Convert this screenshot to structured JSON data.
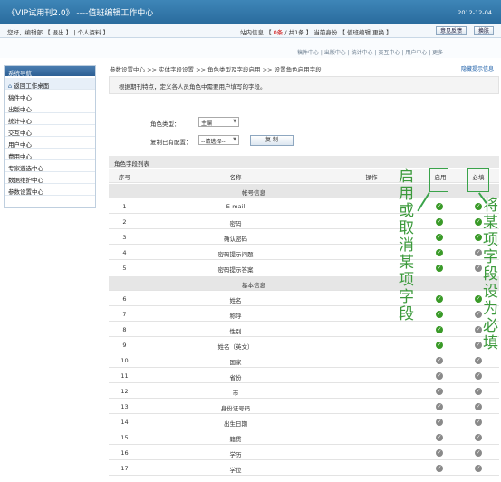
{
  "app": {
    "title": "《VIP试用刊2.0》 ----值班编辑工作中心",
    "date": "2012-12-04"
  },
  "userbar": {
    "left": "您好，编辑部 【 退出 】 | 个人资料 】",
    "right_prefix": "站内信息 【 ",
    "right_count": "0条",
    "right_suffix": " / 共1条 】   当前身份 【 值班编辑 更换 】",
    "help_label": "意见反馈",
    "switch_label": "换肤"
  },
  "nav": {
    "links": "稿件中心 | 出版中心 | 统计中心 | 交互中心 | 用户中心 | 更多"
  },
  "sidebar": {
    "title": "系统导航",
    "home": "返回工作桌面",
    "items": [
      "稿件中心",
      "出版中心",
      "统计中心",
      "交互中心",
      "用户中心",
      "费用中心",
      "专家遴选中心",
      "数据维护中心",
      "参数设置中心"
    ]
  },
  "breadcrumb": "参数设置中心 >> 实体字段设置 >> 角色类型及字段启用 >> 设置角色启用字段",
  "hide_tip": "隐藏提示信息",
  "description": "根据期刊特点，定义各人员角色中需要用户填写的字段。",
  "form": {
    "role_label": "角色类型：",
    "role_value": "主编",
    "copy_label": "复制已有配置：",
    "copy_value": "--请选择--",
    "copy_button": "复 制"
  },
  "table": {
    "title": "角色字段列表",
    "headers": {
      "no": "序号",
      "name": "名称",
      "op": "操作",
      "enable": "启用",
      "required": "必填"
    },
    "group1": "帐号信息",
    "rows1": [
      {
        "no": "1",
        "name": "E-mail",
        "enable": true,
        "required": true
      },
      {
        "no": "2",
        "name": "密码",
        "enable": true,
        "required": true
      },
      {
        "no": "3",
        "name": "确认密码",
        "enable": true,
        "required": true
      },
      {
        "no": "4",
        "name": "密码提示问题",
        "enable": true,
        "required": false
      },
      {
        "no": "5",
        "name": "密码提示答案",
        "enable": true,
        "required": false
      }
    ],
    "group2": "基本信息",
    "rows2": [
      {
        "no": "6",
        "name": "姓名",
        "enable": true,
        "required": true
      },
      {
        "no": "7",
        "name": "称呼",
        "enable": true,
        "required": false
      },
      {
        "no": "8",
        "name": "性别",
        "enable": true,
        "required": false
      },
      {
        "no": "9",
        "name": "姓名（英文）",
        "enable": true,
        "required": false
      },
      {
        "no": "10",
        "name": "国家",
        "enable": false,
        "required": false
      },
      {
        "no": "11",
        "name": "省份",
        "enable": false,
        "required": false
      },
      {
        "no": "12",
        "name": "市",
        "enable": false,
        "required": false
      },
      {
        "no": "13",
        "name": "身份证号码",
        "enable": false,
        "required": false
      },
      {
        "no": "14",
        "name": "出生日期",
        "enable": false,
        "required": false
      },
      {
        "no": "15",
        "name": "籍贯",
        "enable": false,
        "required": false
      },
      {
        "no": "16",
        "name": "学历",
        "enable": false,
        "required": false
      },
      {
        "no": "17",
        "name": "学位",
        "enable": false,
        "required": false
      }
    ]
  },
  "annotations": {
    "enable_text": "启用或取消某项字段",
    "required_text": "将某项字段设为必填"
  },
  "colors": {
    "topbar": "#2e73a8",
    "check_on": "#3a9a28",
    "check_off": "#8a8a8a",
    "annotation": "#3aa34a"
  }
}
